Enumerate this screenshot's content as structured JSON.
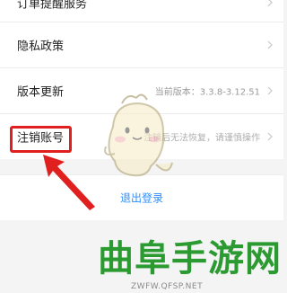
{
  "settings": {
    "rows": [
      {
        "label": "订单提醒服务"
      },
      {
        "label": "隐私政策"
      },
      {
        "label": "版本更新",
        "value": "当前版本：3.3.8-3.12.51"
      },
      {
        "label": "注销账号",
        "value": "注销后无法恢复，请谨慎操作"
      }
    ],
    "logout_label": "退出登录"
  },
  "colors": {
    "accent": "#2b8dff",
    "highlight": "#e0201e",
    "watermark": "#2b9a31"
  },
  "watermark": {
    "title": "曲阜手游网",
    "url": "ZWFW.QFSP.NET"
  }
}
